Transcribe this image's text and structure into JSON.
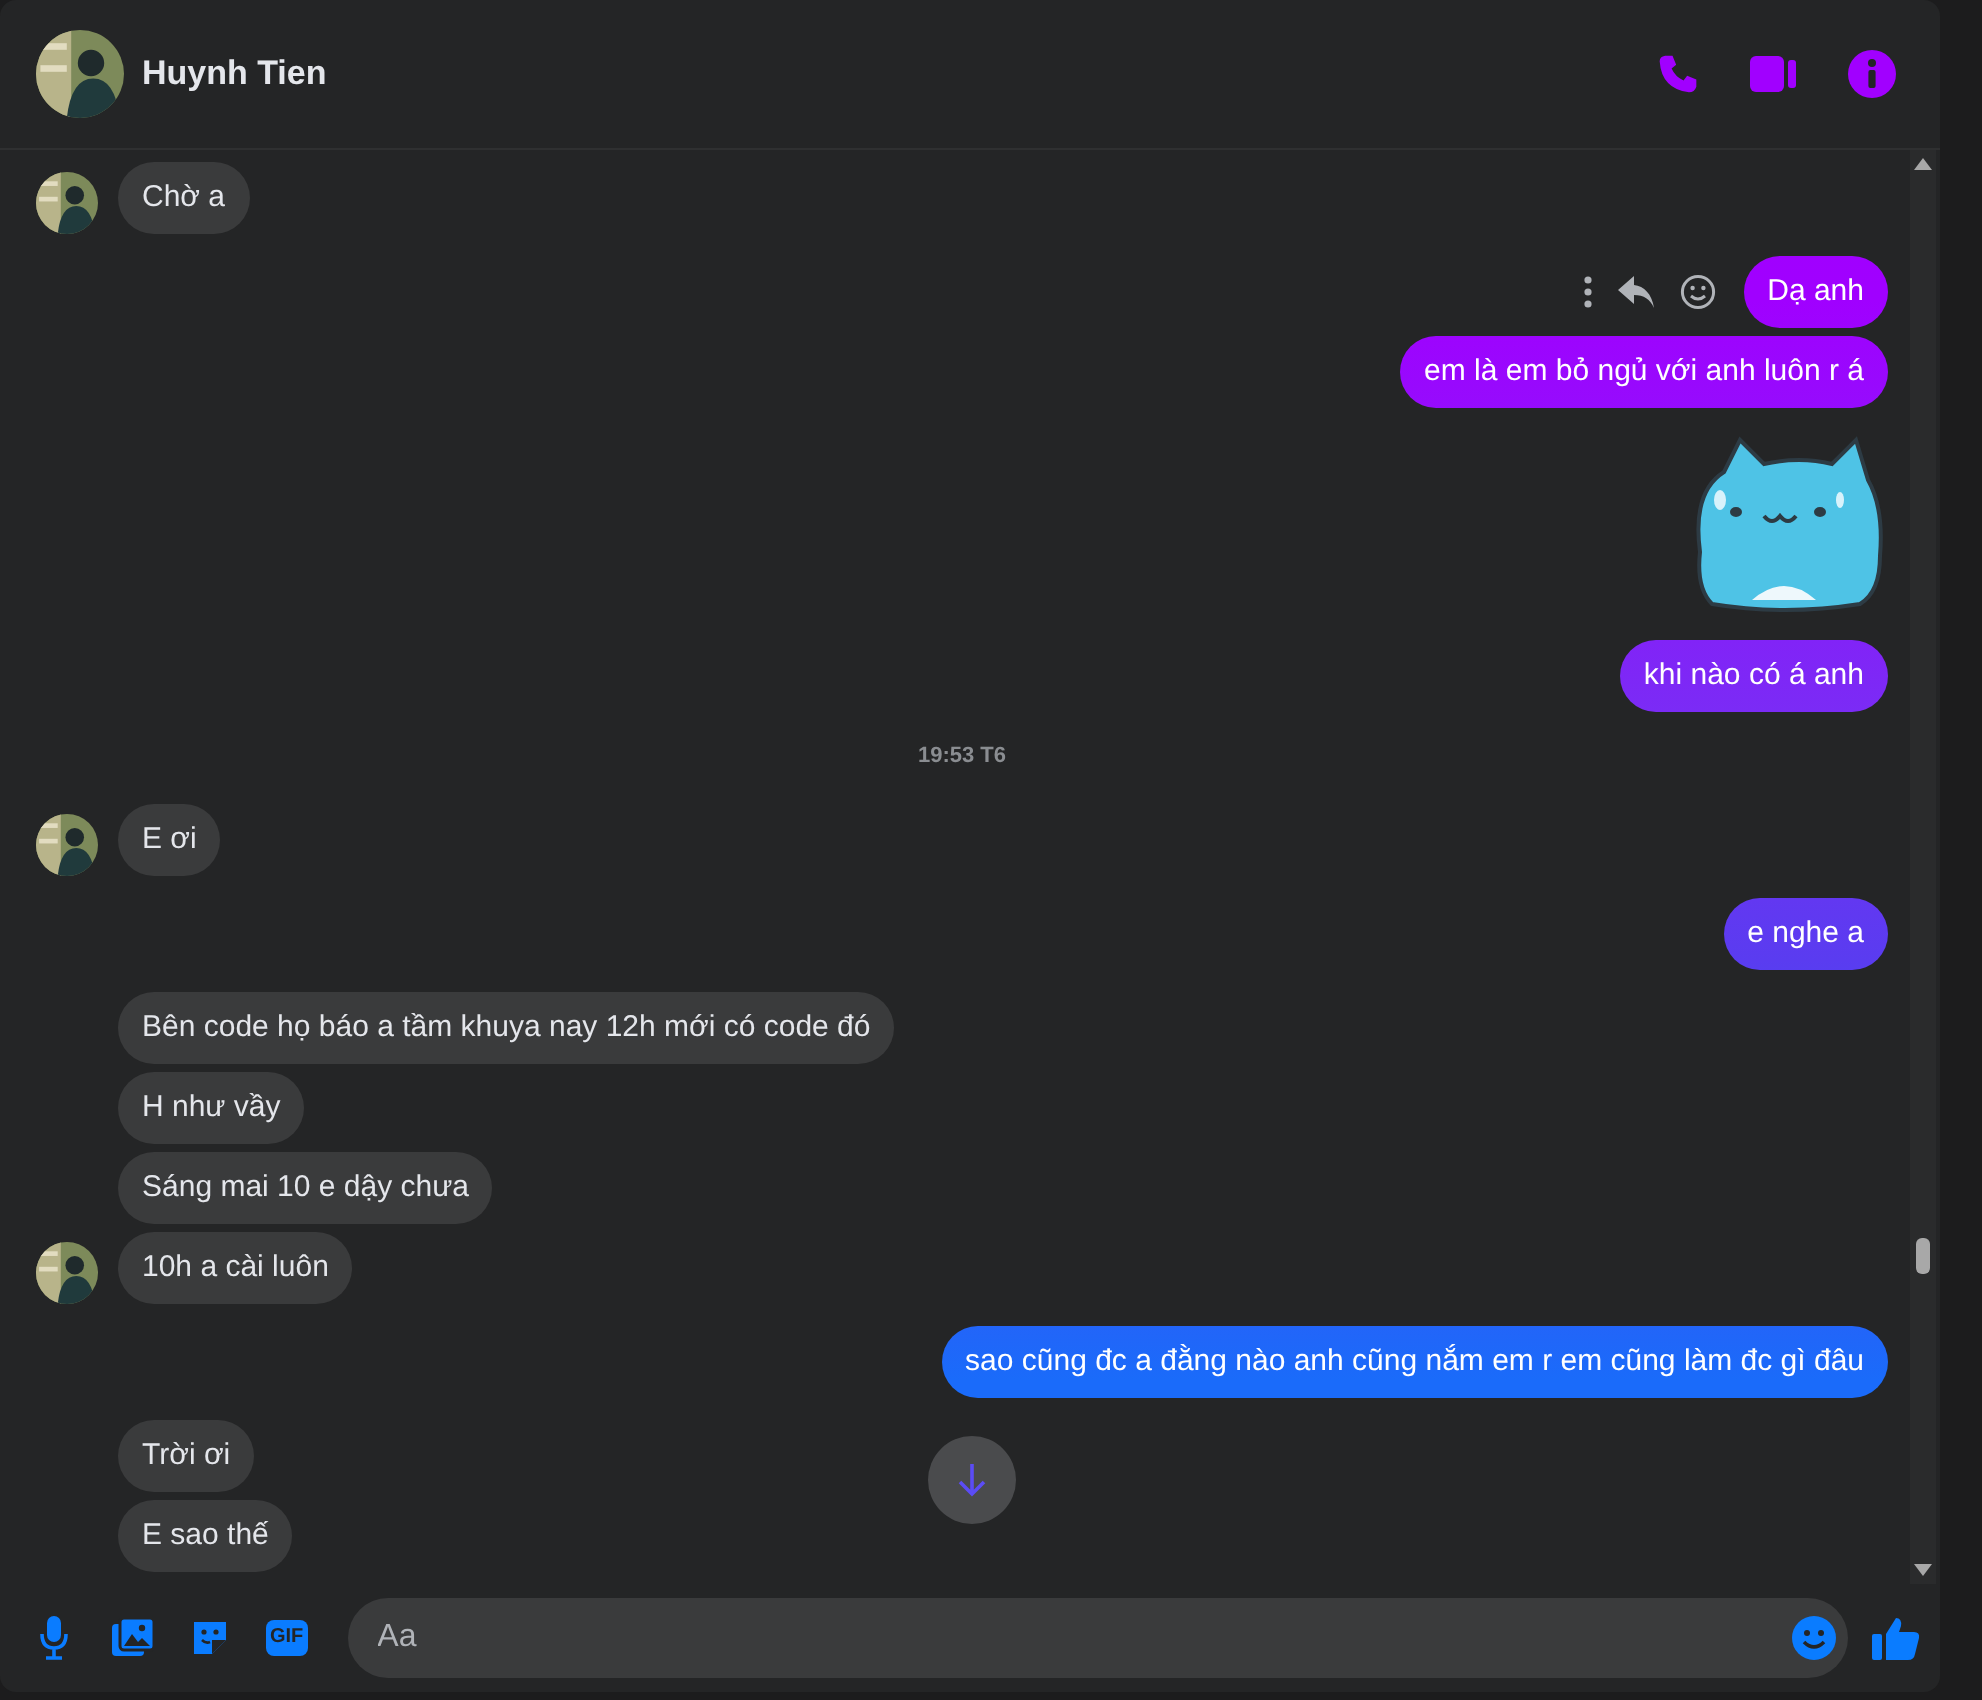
{
  "header": {
    "name": "Huynh Tien"
  },
  "messages": [
    {
      "kind": "in",
      "text": "Chờ a",
      "avatar": true
    },
    {
      "kind": "out",
      "text": "Dạ anh",
      "actions": true
    },
    {
      "kind": "out",
      "text": "em là em bỏ ngủ với anh luôn r á",
      "actions": false
    },
    {
      "kind": "sticker"
    },
    {
      "kind": "out",
      "text": "khi nào có á anh",
      "actions": false
    },
    {
      "kind": "time",
      "text": "19:53 T6"
    },
    {
      "kind": "in",
      "text": "E ơi",
      "avatar": true
    },
    {
      "kind": "out",
      "text": "e nghe a",
      "actions": false
    },
    {
      "kind": "in",
      "text": "Bên code họ báo a tầm khuya nay 12h mới có code đó",
      "avatar": false
    },
    {
      "kind": "in",
      "text": "H như vầy",
      "avatar": false
    },
    {
      "kind": "in",
      "text": "Sáng mai 10 e dậy chưa",
      "avatar": false
    },
    {
      "kind": "in",
      "text": "10h a cài luôn",
      "avatar": true
    },
    {
      "kind": "out",
      "text": "sao cũng đc a đằng nào anh cũng nắm em r em cũng làm đc gì đâu",
      "actions": false
    },
    {
      "kind": "in",
      "text": "Trời ơi",
      "avatar": false
    },
    {
      "kind": "in",
      "text": "E sao thế",
      "avatar": false
    }
  ],
  "composer": {
    "gif_label": "GIF",
    "placeholder": "Aa"
  }
}
